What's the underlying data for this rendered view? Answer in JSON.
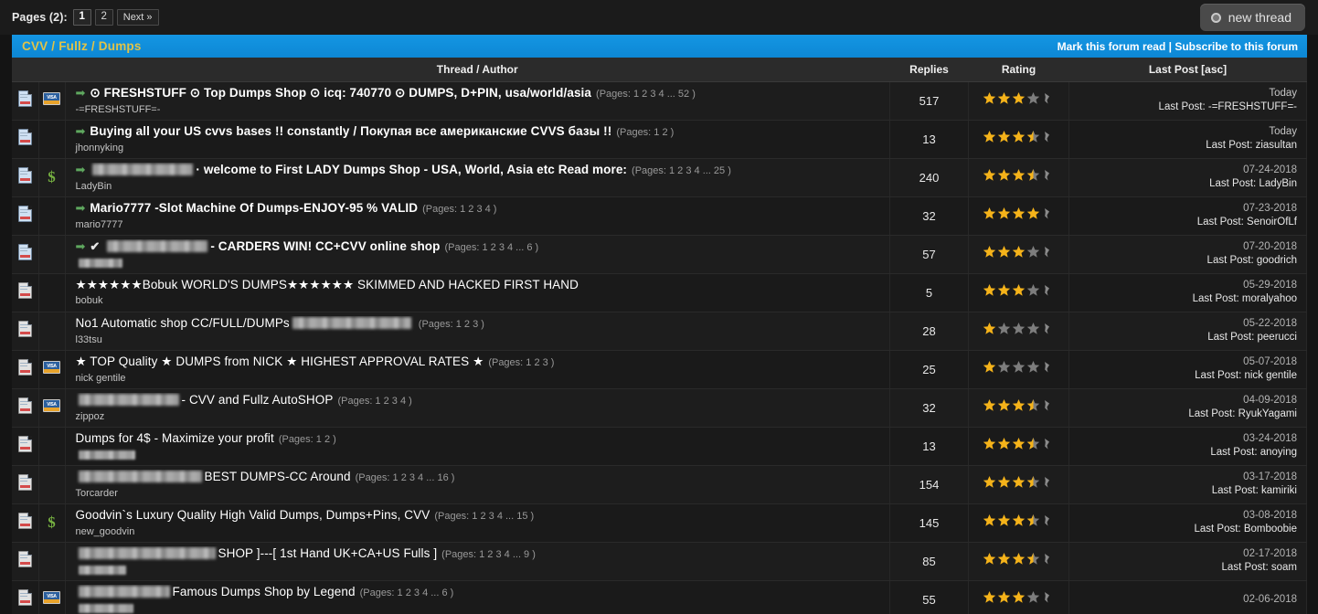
{
  "topbar": {
    "pages_label": "Pages (2):",
    "pages": [
      "1",
      "2"
    ],
    "next_label": "Next »",
    "new_thread_label": "new thread"
  },
  "forum": {
    "title": "CVV / Fullz / Dumps",
    "links": "Mark this forum read | Subscribe to this forum"
  },
  "table": {
    "headers": {
      "thread": "Thread / Author",
      "replies": "Replies",
      "rating": "Rating",
      "lastpost": "Last Post [asc]"
    }
  },
  "rows": [
    {
      "icon1": "doc-blue-icon",
      "icon2": "credit-card-icon",
      "arrow": "➡",
      "check": "",
      "title_pre": "",
      "title": "⊙ FRESHSTUFF ⊙ Top Dumps Shop ⊙ icq: 740770 ⊙ DUMPS, D+PIN, usa/world/asia",
      "bold": true,
      "pages": "(Pages: 1 2 3 4 ... 52 )",
      "author": "-=FRESHSTUFF=-",
      "author_redacted": false,
      "replies": "517",
      "rating": 3.0,
      "date": "Today",
      "last_post": "Last Post: -=FRESHSTUFF=-"
    },
    {
      "icon1": "doc-blue-icon",
      "icon2": "",
      "arrow": "➡",
      "check": "",
      "title_pre": "",
      "title": "Buying all your US cvvs bases !! constantly / Покупая все американские CVVS базы !!",
      "bold": true,
      "pages": "(Pages: 1 2 )",
      "author": "jhonnyking",
      "author_redacted": false,
      "replies": "13",
      "rating": 3.5,
      "date": "Today",
      "last_post": "Last Post: ziasultan"
    },
    {
      "icon1": "doc-blue-icon",
      "icon2": "dollar-icon",
      "arrow": "➡",
      "check": "",
      "title_pre": "REDACTED",
      "title": "· welcome to First LADY Dumps Shop - USA, World, Asia etc Read more:",
      "bold": true,
      "pages": "(Pages: 1 2 3 4 ... 25 )",
      "author": "LadyBin",
      "author_redacted": false,
      "replies": "240",
      "rating": 3.5,
      "date": "07-24-2018",
      "last_post": "Last Post: LadyBin"
    },
    {
      "icon1": "doc-blue-icon",
      "icon2": "",
      "arrow": "➡",
      "check": "",
      "title_pre": "",
      "title": "Mario7777 -Slot Machine Of Dumps-ENJOY-95 % VALID",
      "bold": true,
      "pages": "(Pages: 1 2 3 4 )",
      "author": "mario7777",
      "author_redacted": false,
      "replies": "32",
      "rating": 4.5,
      "date": "07-23-2018",
      "last_post": "Last Post: SenoirOfLf"
    },
    {
      "icon1": "doc-blue-icon",
      "icon2": "",
      "arrow": "➡",
      "check": "✔",
      "title_pre": "REDACTED",
      "title": "- CARDERS WIN! CC+CVV online shop",
      "bold": true,
      "pages": "(Pages: 1 2 3 4 ... 6 )",
      "author": "",
      "author_redacted": true,
      "replies": "57",
      "rating": 3.0,
      "date": "07-20-2018",
      "last_post": "Last Post: goodrich"
    },
    {
      "icon1": "doc-grey-icon",
      "icon2": "",
      "arrow": "",
      "check": "",
      "title_pre": "",
      "title": "★★★★★★Bobuk WORLD'S DUMPS★★★★★★ SKIMMED AND HACKED FIRST HAND",
      "bold": false,
      "pages": "",
      "author": "bobuk",
      "author_redacted": false,
      "replies": "5",
      "rating": 3.0,
      "date": "05-29-2018",
      "last_post": "Last Post: moralyahoo"
    },
    {
      "icon1": "doc-grey-icon",
      "icon2": "",
      "arrow": "",
      "check": "",
      "title_pre": "",
      "title": "No1 Automatic shop CC/FULL/DUMPs",
      "title_post_redacted": true,
      "bold": false,
      "pages": "(Pages: 1 2 3 )",
      "author": "l33tsu",
      "author_redacted": false,
      "replies": "28",
      "rating": 1.0,
      "date": "05-22-2018",
      "last_post": "Last Post: peerucci"
    },
    {
      "icon1": "doc-grey-icon",
      "icon2": "credit-card-icon",
      "arrow": "",
      "check": "",
      "title_pre": "",
      "title": "★ TOP Quality ★ DUMPS from NICK ★ HIGHEST APPROVAL RATES ★",
      "bold": false,
      "pages": "(Pages: 1 2 3 )",
      "author": "nick gentile",
      "author_redacted": false,
      "replies": "25",
      "rating": 1.0,
      "date": "05-07-2018",
      "last_post": "Last Post: nick gentile"
    },
    {
      "icon1": "doc-grey-icon",
      "icon2": "credit-card-icon",
      "arrow": "",
      "check": "",
      "title_pre": "REDACTED",
      "title": "- CVV and Fullz AutoSHOP",
      "bold": false,
      "pages": "(Pages: 1 2 3 4 )",
      "author": "zippoz",
      "author_redacted": false,
      "replies": "32",
      "rating": 3.5,
      "date": "04-09-2018",
      "last_post": "Last Post: RyukYagami"
    },
    {
      "icon1": "doc-grey-icon",
      "icon2": "",
      "arrow": "",
      "check": "",
      "title_pre": "",
      "title": "Dumps for 4$ - Maximize your profit",
      "bold": false,
      "pages": "(Pages: 1 2 )",
      "author": "",
      "author_redacted": true,
      "replies": "13",
      "rating": 3.5,
      "date": "03-24-2018",
      "last_post": "Last Post: anoying"
    },
    {
      "icon1": "doc-grey-icon",
      "icon2": "",
      "arrow": "",
      "check": "",
      "title_pre": "REDACTED",
      "title": "BEST DUMPS-CC Around",
      "bold": false,
      "pages": "(Pages: 1 2 3 4 ... 16 )",
      "author": "Torcarder",
      "author_redacted": false,
      "replies": "154",
      "rating": 3.5,
      "date": "03-17-2018",
      "last_post": "Last Post: kamiriki"
    },
    {
      "icon1": "doc-grey-icon",
      "icon2": "dollar-icon",
      "arrow": "",
      "check": "",
      "title_pre": "",
      "title": "Goodvin`s Luxury Quality High Valid Dumps, Dumps+Pins, CVV",
      "bold": false,
      "pages": "(Pages: 1 2 3 4 ... 15 )",
      "author": "new_goodvin",
      "author_redacted": false,
      "replies": "145",
      "rating": 3.5,
      "date": "03-08-2018",
      "last_post": "Last Post: Bomboobie"
    },
    {
      "icon1": "doc-grey-icon",
      "icon2": "",
      "arrow": "",
      "check": "",
      "title_pre": "REDACTED",
      "title": "SHOP ]---[ 1st Hand UK+CA+US Fulls ]",
      "bold": false,
      "pages": "(Pages: 1 2 3 4 ... 9 )",
      "author": "",
      "author_redacted": true,
      "replies": "85",
      "rating": 3.5,
      "date": "02-17-2018",
      "last_post": "Last Post: soam"
    },
    {
      "icon1": "doc-grey-icon",
      "icon2": "credit-card-icon",
      "arrow": "",
      "check": "",
      "title_pre": "REDACTED",
      "title": "Famous Dumps Shop by Legend",
      "bold": false,
      "pages": "(Pages: 1 2 3 4 ... 6 )",
      "author": "",
      "author_redacted": true,
      "replies": "55",
      "rating": 3.0,
      "date": "02-06-2018",
      "last_post": ""
    }
  ],
  "colors": {
    "accent_blue": "#1496e3",
    "title_gold": "#e0c349",
    "star_filled": "#f5b31a",
    "star_empty": "#7d7d7d",
    "arrow_green": "#5fa85f",
    "page_bg": "#141414"
  }
}
